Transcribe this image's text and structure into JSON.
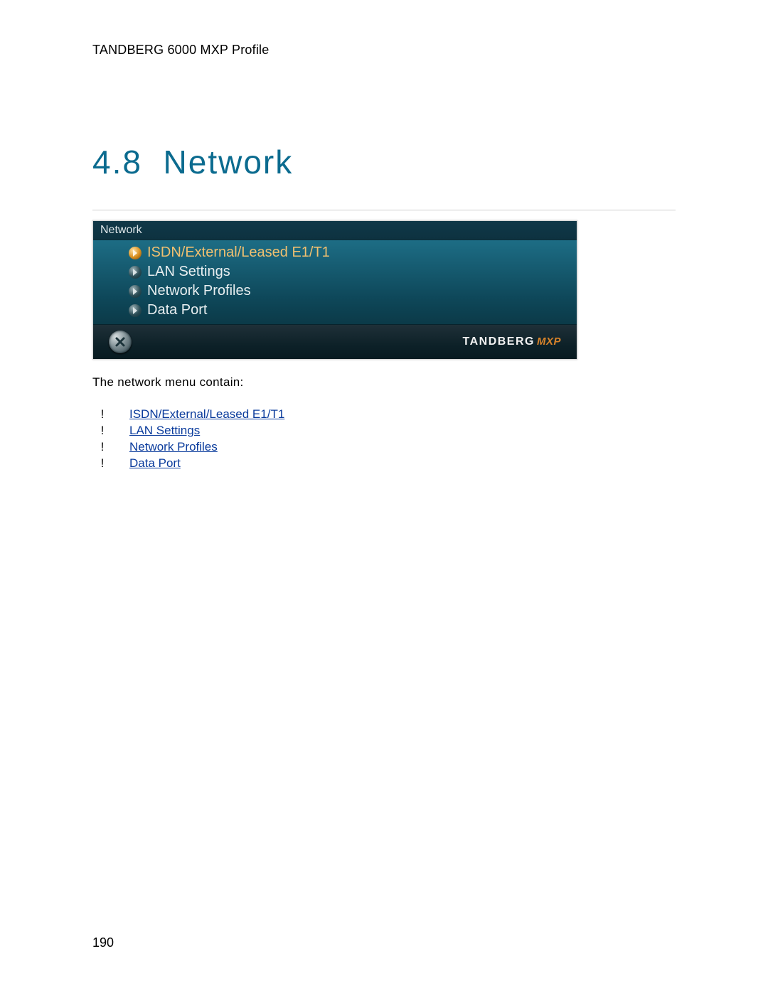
{
  "header": "TANDBERG 6000 MXP Profile",
  "section_number": "4.8",
  "section_title": "Network",
  "panel": {
    "title": "Network",
    "items": [
      {
        "label": "ISDN/External/Leased E1/T1",
        "selected": true
      },
      {
        "label": "LAN Settings",
        "selected": false
      },
      {
        "label": "Network Profiles",
        "selected": false
      },
      {
        "label": "Data Port",
        "selected": false
      }
    ],
    "brand_main": "TANDBERG",
    "brand_sub": "MXP"
  },
  "subhead": "The network menu contain:",
  "link_marker": "!",
  "links": [
    "ISDN/External/Leased E1/T1",
    "LAN Settings",
    "Network Profiles",
    "Data Port"
  ],
  "page_number": "190"
}
